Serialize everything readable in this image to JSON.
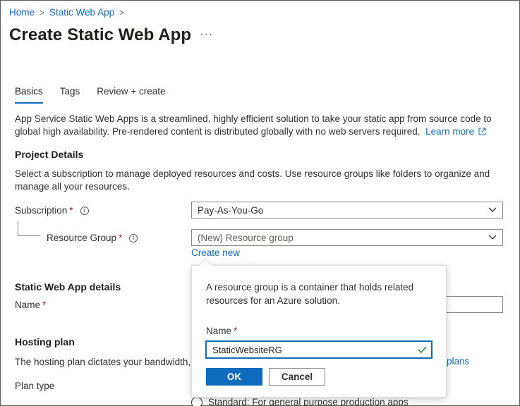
{
  "breadcrumb": {
    "home": "Home",
    "current": "Static Web App",
    "separator": ">"
  },
  "page": {
    "title": "Create Static Web App",
    "more": "···"
  },
  "tabs": [
    {
      "label": "Basics",
      "active": true
    },
    {
      "label": "Tags",
      "active": false
    },
    {
      "label": "Review + create",
      "active": false
    }
  ],
  "intro": {
    "text": "App Service Static Web Apps is a streamlined, highly efficient solution to take your static app from source code to global high availability. Pre-rendered content is distributed globally with no web servers required.",
    "learn_more": "Learn more"
  },
  "project_details": {
    "title": "Project Details",
    "description": "Select a subscription to manage deployed resources and costs. Use resource groups like folders to organize and manage all your resources.",
    "subscription_label": "Subscription",
    "subscription_value": "Pay-As-You-Go",
    "resource_group_label": "Resource Group",
    "resource_group_value": "(New) Resource group",
    "create_new": "Create new",
    "required_mark": "*"
  },
  "app_details": {
    "title": "Static Web App details",
    "name_label": "Name"
  },
  "hosting": {
    "title": "Hosting plan",
    "description": "The hosting plan dictates your bandwidth, c",
    "plans_link": "plans",
    "plan_type_label": "Plan type",
    "standard_option": "Standard: For general purpose production apps"
  },
  "popup": {
    "description": "A resource group is a container that holds related resources for an Azure solution.",
    "name_label": "Name",
    "name_value": "StaticWebsiteRG",
    "ok_label": "OK",
    "cancel_label": "Cancel"
  },
  "colors": {
    "accent": "#0f6cbd",
    "required": "#a4262c",
    "valid_check": "#107c10"
  },
  "icons": {
    "info": "info-icon",
    "chevron": "chevron-down-icon",
    "external": "external-link-icon",
    "check": "checkmark-icon"
  }
}
